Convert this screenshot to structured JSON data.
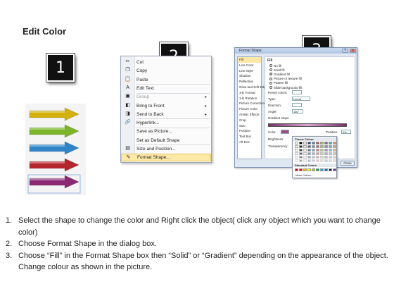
{
  "title": "Edit Color",
  "badges": [
    "1",
    "2",
    "3"
  ],
  "arrows": {
    "colors": [
      "#d4b00c",
      "#7cb52a",
      "#2f84c8",
      "#b5262f",
      "#8b2a73"
    ]
  },
  "context_menu": {
    "items": [
      {
        "label": "Cut",
        "icon": "scissors-icon",
        "glyph": "✂"
      },
      {
        "label": "Copy",
        "icon": "copy-icon",
        "glyph": "❐"
      },
      {
        "label": "Paste",
        "icon": "paste-icon",
        "glyph": "📋"
      },
      {
        "label": "Edit Text",
        "icon": "edit-text-icon",
        "glyph": "A"
      },
      {
        "label": "Group",
        "icon": "group-icon",
        "glyph": "▣",
        "disabled": true,
        "submenu": true
      },
      {
        "label": "Bring to Front",
        "icon": "bring-front-icon",
        "glyph": "◧",
        "submenu": true
      },
      {
        "label": "Send to Back",
        "icon": "send-back-icon",
        "glyph": "◨",
        "submenu": true
      },
      {
        "label": "Hyperlink...",
        "icon": "hyperlink-icon",
        "glyph": "🔗"
      },
      {
        "label": "Save as Picture...",
        "icon": "",
        "glyph": ""
      },
      {
        "label": "Set as Default Shape",
        "icon": "",
        "glyph": ""
      },
      {
        "label": "Size and Position...",
        "icon": "size-position-icon",
        "glyph": "▤"
      },
      {
        "label": "Format Shape...",
        "icon": "format-shape-icon",
        "glyph": "✎",
        "highlighted": true
      }
    ]
  },
  "dialog": {
    "title": "Format Shape",
    "close_label": "Close",
    "minimize": "?",
    "close_x": "x",
    "nav": [
      "Fill",
      "Line Color",
      "Line Style",
      "Shadow",
      "Reflection",
      "Glow and Soft Edges",
      "3-D Format",
      "3-D Rotation",
      "Picture Corrections",
      "Picture Color",
      "Artistic Effects",
      "Crop",
      "Size",
      "Position",
      "Text Box",
      "Alt Text"
    ],
    "pane_title": "Fill",
    "fill_options": [
      "No fill",
      "Solid fill",
      "Gradient fill",
      "Picture or texture fill",
      "Pattern fill",
      "Slide background fill"
    ],
    "selected_option": "Gradient fill",
    "preset_colors_label": "Preset colors:",
    "type_label": "Type:",
    "type_value": "Linear",
    "direction_label": "Direction:",
    "angle_label": "Angle:",
    "angle_value": "180°",
    "gradient_stops_label": "Gradient stops",
    "color_label": "Color",
    "position_label": "Position:",
    "position_value": "0%",
    "brightness_label": "Brightness:",
    "transparency_label": "Transparency:"
  },
  "palette": {
    "theme_header": "Theme Colors",
    "standard_header": "Standard Colors",
    "more_colors": "More Colors...",
    "theme_row": [
      "#ffffff",
      "#000000",
      "#eeece1",
      "#1f497d",
      "#4f81bd",
      "#c0504d",
      "#9bbb59",
      "#8064a2",
      "#4bacc6",
      "#f79646"
    ],
    "standard_row": [
      "#c00000",
      "#ff0000",
      "#ffc000",
      "#ffff00",
      "#92d050",
      "#00b050",
      "#00b0f0",
      "#0070c0",
      "#002060",
      "#7030a0"
    ]
  },
  "instructions": [
    {
      "num": "1.",
      "text": "Select the shape to change the color and Right click the object( click any object which you want to change color)"
    },
    {
      "num": "2.",
      "text": "Choose Format Shape in the dialog box."
    },
    {
      "num": "3.",
      "text": "Choose “Fill” in the Format Shape box then “Solid” or “Gradient” depending on the appearance of the object. Change colour as shown in the picture."
    }
  ]
}
